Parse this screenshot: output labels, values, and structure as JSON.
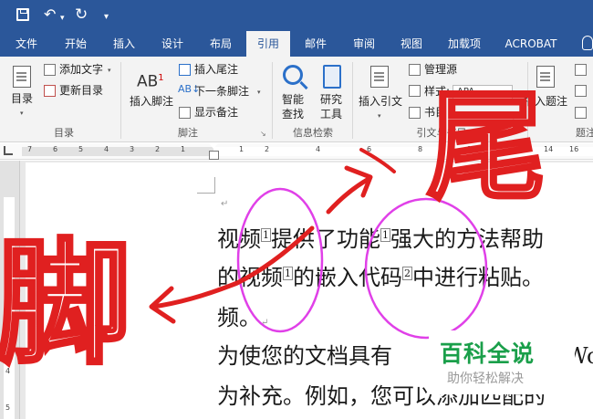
{
  "tabs": [
    "文件",
    "开始",
    "插入",
    "设计",
    "布局",
    "引用",
    "邮件",
    "审阅",
    "视图",
    "加载项",
    "ACROBAT"
  ],
  "active_tab": "引用",
  "ribbon": {
    "toc": {
      "label": "目录",
      "add_text": "添加文字",
      "update_toc": "更新目录",
      "group": "目录"
    },
    "footnotes": {
      "insert_footnote": "插入脚注",
      "ab_icon": "AB",
      "ab_sup": "1",
      "insert_endnote": "插入尾注",
      "next_footnote": "下一条脚注",
      "show_notes": "显示备注",
      "group": "脚注"
    },
    "research": {
      "smart_lookup_1": "智能",
      "smart_lookup_2": "查找",
      "researcher_1": "研究",
      "researcher_2": "工具",
      "group": "信息检索"
    },
    "citations": {
      "insert_citation": "插入引文",
      "manage_sources": "管理源",
      "style_label": "样式:",
      "style_value": "APA",
      "bibliography": "书目",
      "group": "引文与书目"
    },
    "captions": {
      "insert_caption": "插入题注",
      "group": "题注"
    }
  },
  "ruler_numbers": [
    "7",
    "6",
    "5",
    "4",
    "3",
    "2",
    "1",
    "1",
    "2",
    "4",
    "6",
    "8",
    "10",
    "12",
    "14",
    "16",
    "18"
  ],
  "vruler_numbers": [
    "1",
    "2",
    "3",
    "4",
    "5"
  ],
  "document": {
    "line1": [
      "视频",
      "1",
      "提供了功能",
      "1",
      "强大的方法帮助"
    ],
    "line2": [
      "的视频",
      "1",
      "的嵌入代码",
      "2",
      "中进行粘贴。"
    ],
    "line3": "频。",
    "line4_a": "为使您的文档具有",
    "line4_b": "Wo",
    "line5": "为补充。例如，您可以添加匹配的"
  },
  "annotations": {
    "left_char": "脚",
    "right_char": "尾"
  },
  "watermark": {
    "title": "百科全说",
    "subtitle": "助你轻松解决"
  },
  "colors": {
    "titlebar": "#2b579a",
    "annotation_red": "#e02020",
    "annotation_magenta": "#e040e8",
    "watermark_green": "#1a9f4a"
  }
}
